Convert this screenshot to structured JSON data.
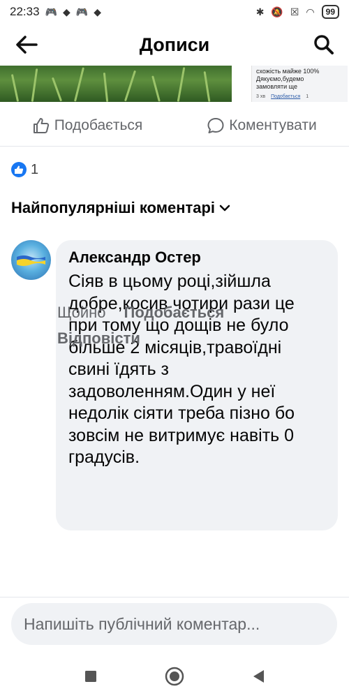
{
  "status_bar": {
    "time": "22:33",
    "battery": "99"
  },
  "header": {
    "title": "Дописи"
  },
  "post": {
    "screenshot_text": "схожість майже 100%\nДякуємо,будемо\nзамовляти ще",
    "screenshot_time": "3 хв",
    "screenshot_like": "Подобається",
    "screenshot_count": "1"
  },
  "actions": {
    "like_label": "Подобається",
    "comment_label": "Коментувати"
  },
  "reactions": {
    "count": "1"
  },
  "sort": {
    "label": "Найпопулярніші коментарі"
  },
  "comment": {
    "author": "Александр Остер",
    "text": "Сіяв в цьому році,зійшла добре,косив чотири рази це при тому що дощів не було більше 2 місяців,травоїдні свині їдять з задоволенням.Один у неї недолік сіяти треба пізно бо зовсім не витримує навіть 0 градусів.",
    "time": "Щойно",
    "like_label": "Подобається",
    "reply_label": "Відповісти"
  },
  "composer": {
    "placeholder": "Напишіть публічний коментар..."
  },
  "colors": {
    "facebook_blue": "#1877f2",
    "secondary_text": "#65676b",
    "bubble": "#f0f2f5"
  }
}
